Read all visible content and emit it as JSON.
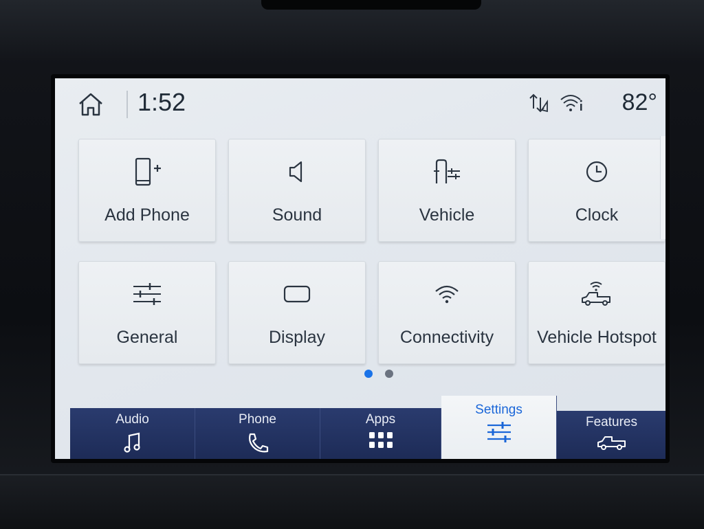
{
  "status": {
    "time": "1:52",
    "temperature": "82°",
    "icons": [
      "home-icon",
      "data-transfer-icon",
      "wifi-info-icon"
    ]
  },
  "tiles": [
    {
      "label": "Add Phone",
      "icon": "add-phone-icon"
    },
    {
      "label": "Sound",
      "icon": "speaker-icon"
    },
    {
      "label": "Vehicle",
      "icon": "vehicle-settings-icon"
    },
    {
      "label": "Clock",
      "icon": "clock-icon"
    },
    {
      "label": "General",
      "icon": "sliders-icon"
    },
    {
      "label": "Display",
      "icon": "display-icon"
    },
    {
      "label": "Connectivity",
      "icon": "wifi-icon"
    },
    {
      "label": "Vehicle Hotspot",
      "icon": "truck-wifi-icon"
    }
  ],
  "pager": {
    "current": 1,
    "total": 2,
    "active_color": "#1a73e8",
    "inactive_color": "#6b7380"
  },
  "nav": {
    "tabs": [
      {
        "label": "Audio",
        "icon": "music-note-icon"
      },
      {
        "label": "Phone",
        "icon": "phone-handset-icon"
      },
      {
        "label": "Apps",
        "icon": "app-grid-icon"
      },
      {
        "label": "Settings",
        "icon": "settings-sliders-icon",
        "active": true
      },
      {
        "label": "Features",
        "icon": "truck-icon"
      }
    ],
    "active_color": "#1a66d8",
    "bar_color": "#1c2a55"
  }
}
